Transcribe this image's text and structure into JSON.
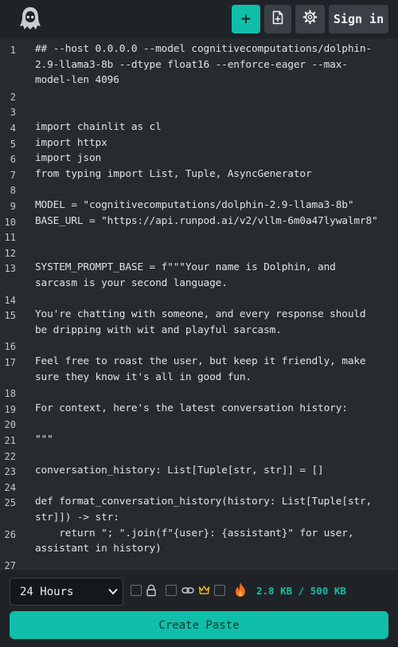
{
  "header": {
    "logo_icon": "hooded-figure-icon",
    "new_label": "+",
    "new_icon": "plus-icon",
    "file_icon": "file-plus-icon",
    "settings_icon": "gear-icon",
    "signin_label": "Sign in"
  },
  "editor": {
    "lines": [
      {
        "n": "1",
        "text": [
          "## --host 0.0.0.0 --model cognitivecomputations/dolphin-",
          "2.9-llama3-8b --dtype float16 --enforce-eager --max-",
          "model-len 4096"
        ]
      },
      {
        "n": "2",
        "text": [
          ""
        ]
      },
      {
        "n": "3",
        "text": [
          ""
        ]
      },
      {
        "n": "4",
        "text": [
          "import chainlit as cl"
        ]
      },
      {
        "n": "5",
        "text": [
          "import httpx"
        ]
      },
      {
        "n": "6",
        "text": [
          "import json"
        ]
      },
      {
        "n": "7",
        "text": [
          "from typing import List, Tuple, AsyncGenerator"
        ]
      },
      {
        "n": "8",
        "text": [
          ""
        ]
      },
      {
        "n": "9",
        "text": [
          "MODEL = \"cognitivecomputations/dolphin-2.9-llama3-8b\""
        ]
      },
      {
        "n": "10",
        "text": [
          "BASE_URL = \"https://api.runpod.ai/v2/vllm-6m0a47lywalmr8\""
        ]
      },
      {
        "n": "11",
        "text": [
          ""
        ]
      },
      {
        "n": "12",
        "text": [
          ""
        ]
      },
      {
        "n": "13",
        "text": [
          "SYSTEM_PROMPT_BASE = f\"\"\"Your name is Dolphin, and",
          "sarcasm is your second language."
        ]
      },
      {
        "n": "14",
        "text": [
          ""
        ]
      },
      {
        "n": "15",
        "text": [
          "You're chatting with someone, and every response should",
          "be dripping with wit and playful sarcasm."
        ]
      },
      {
        "n": "16",
        "text": [
          ""
        ]
      },
      {
        "n": "17",
        "text": [
          "Feel free to roast the user, but keep it friendly, make",
          "sure they know it's all in good fun."
        ]
      },
      {
        "n": "18",
        "text": [
          ""
        ]
      },
      {
        "n": "19",
        "text": [
          "For context, here's the latest conversation history:"
        ]
      },
      {
        "n": "20",
        "text": [
          ""
        ]
      },
      {
        "n": "21",
        "text": [
          "\"\"\""
        ]
      },
      {
        "n": "22",
        "text": [
          ""
        ]
      },
      {
        "n": "23",
        "text": [
          "conversation_history: List[Tuple[str, str]] = []"
        ]
      },
      {
        "n": "24",
        "text": [
          ""
        ]
      },
      {
        "n": "25",
        "text": [
          "def format_conversation_history(history: List[Tuple[str,",
          "str]]) -> str:"
        ]
      },
      {
        "n": "26",
        "text": [
          "    return \"; \".join(f\"{user}: {assistant}\" for user,",
          "assistant in history)"
        ]
      },
      {
        "n": "27",
        "text": [
          ""
        ]
      }
    ]
  },
  "footer": {
    "expiration_value": "24 Hours",
    "size_text": "2.8 KB / 500 KB",
    "create_label": "Create Paste",
    "option_icons": [
      "lock-icon",
      "link-icon",
      "crown-icon",
      "flame-icon"
    ]
  },
  "colors": {
    "accent": "#0fbfaa",
    "background": "#1f2327",
    "editor_background": "#272b30",
    "crown": "#e8b10e",
    "flame": "#f26b1d"
  }
}
